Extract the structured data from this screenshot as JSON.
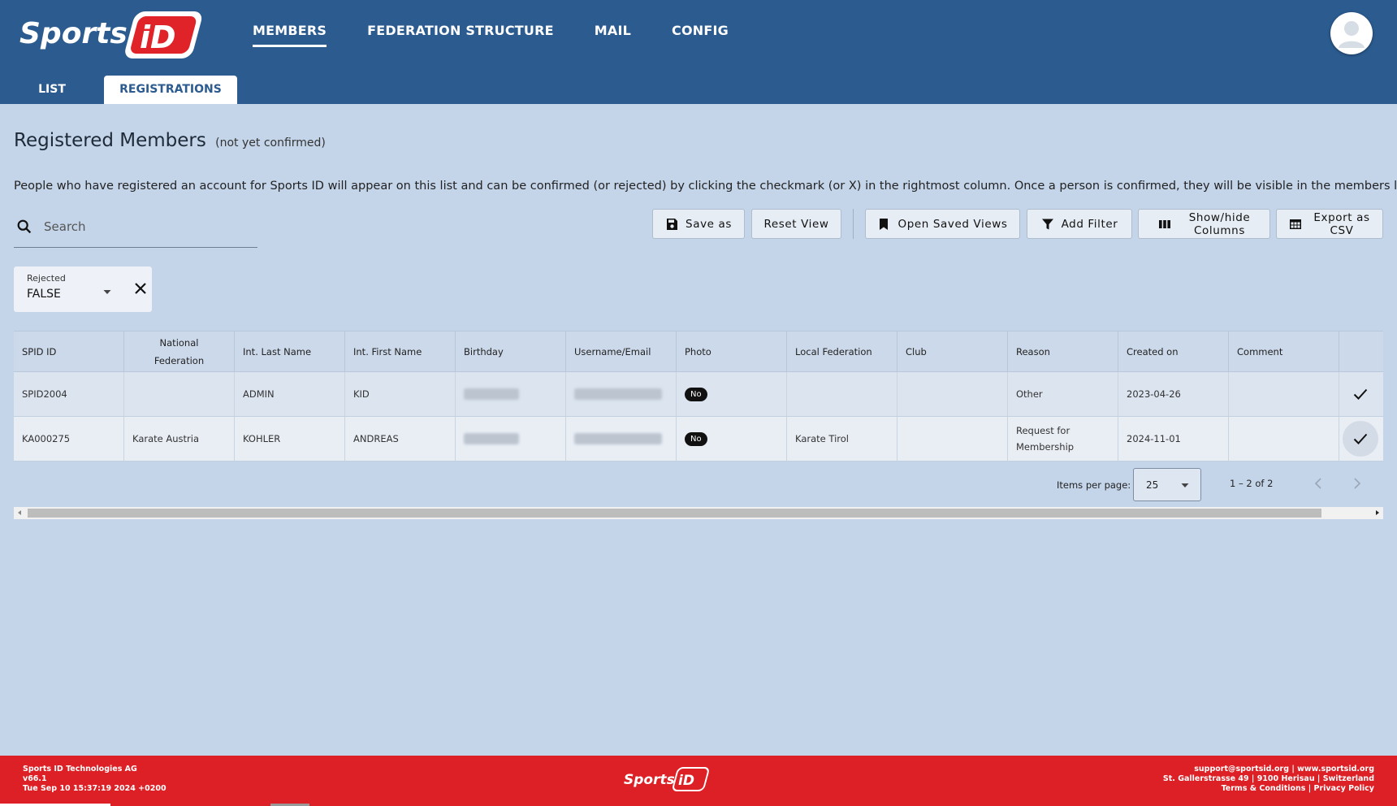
{
  "brand": {
    "name": "Sports",
    "mark": "iD"
  },
  "nav": {
    "items": [
      "MEMBERS",
      "FEDERATION STRUCTURE",
      "MAIL",
      "CONFIG"
    ],
    "active": "MEMBERS"
  },
  "subtabs": [
    "LIST",
    "REGISTRATIONS"
  ],
  "page": {
    "title": "Registered Members",
    "title_note": "(not yet confirmed)",
    "description": "People who have registered an account for Sports ID will appear on this list and can be confirmed (or rejected) by clicking the checkmark (or X) in the rightmost column. Once a person is confirmed, they will be visible in the members list."
  },
  "search": {
    "placeholder": "Search",
    "value": ""
  },
  "toolbar": {
    "save_as": "Save as",
    "reset_view": "Reset View",
    "open_saved_views": "Open Saved Views",
    "add_filter": "Add Filter",
    "show_hide_columns_1": "Show/hide",
    "show_hide_columns_2": "Columns",
    "export_csv_1": "Export as",
    "export_csv_2": "CSV"
  },
  "filter": {
    "label": "Rejected",
    "value": "FALSE"
  },
  "table": {
    "headers": {
      "spid": "SPID ID",
      "national_1": "National",
      "national_2": "Federation",
      "last_name": "Int. Last Name",
      "first_name": "Int. First Name",
      "birthday": "Birthday",
      "email": "Username/Email",
      "photo": "Photo",
      "local_fed": "Local Federation",
      "club": "Club",
      "reason": "Reason",
      "created": "Created on",
      "comment": "Comment"
    },
    "rows": [
      {
        "spid": "SPID2004",
        "national": "",
        "last_name": "ADMIN",
        "first_name": "KID",
        "photo": "No",
        "local_fed": "",
        "club": "",
        "reason_1": "Other",
        "reason_2": "",
        "created": "2023-04-26",
        "comment": ""
      },
      {
        "spid": "KA000275",
        "national": "Karate Austria",
        "last_name": "KOHLER",
        "first_name": "ANDREAS",
        "photo": "No",
        "local_fed": "Karate Tirol",
        "club": "",
        "reason_1": "Request for",
        "reason_2": "Membership",
        "created": "2024-11-01",
        "comment": ""
      }
    ]
  },
  "pager": {
    "label": "Items per page:",
    "size": "25",
    "range": "1 – 2 of 2"
  },
  "footer": {
    "company": "Sports ID Technologies AG",
    "version": "v66.1",
    "timestamp": "Tue Sep 10 15:37:19 2024 +0200",
    "contact": "support@sportsid.org | www.sportsid.org",
    "address": "St. Gallerstrasse 49 | 9100 Herisau | Switzerland",
    "legal": "Terms & Conditions | Privacy Policy"
  },
  "colors": {
    "header": "#2b5b8f",
    "footer": "#dd2025",
    "background": "#c4d5ea",
    "brand_red": "#e02328"
  },
  "icons": [
    "search-icon",
    "save-icon",
    "bookmark-icon",
    "filter-icon",
    "columns-icon",
    "table-icon",
    "close-icon",
    "chevron-down-icon",
    "check-icon",
    "chevron-left-icon",
    "chevron-right-icon",
    "user-avatar-icon"
  ]
}
